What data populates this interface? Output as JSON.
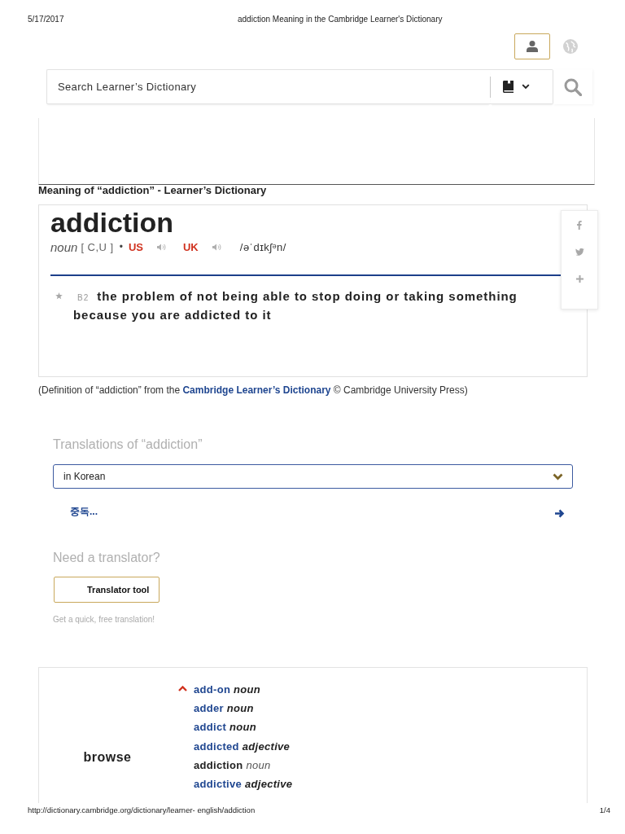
{
  "print_header": {
    "date": "5/17/2017",
    "title": "addiction Meaning in the Cambridge Learner's Dictionary"
  },
  "search": {
    "placeholder": "Search Learner’s Dictionary"
  },
  "meaning_heading": "Meaning of “addiction” - Learner’s Dictionary",
  "entry": {
    "headword": "addiction",
    "pos": "noun",
    "grammar": "[ C,U ]",
    "separator": "•",
    "pronunciations": [
      {
        "region": "US"
      },
      {
        "region": "UK"
      }
    ],
    "ipa": "/əˈdɪkʃᵊn/",
    "cefr": "B2",
    "definition": "the problem of not being able to stop doing or taking something because you are addicted to it"
  },
  "attribution": {
    "before": "(Definition of “addiction” from the ",
    "link": "Cambridge Learner’s Dictionary",
    "after": " © Cambridge University Press)"
  },
  "translations": {
    "heading": "Translations of “addiction”",
    "language": "in Korean",
    "result": "중독..."
  },
  "translator": {
    "heading": "Need a translator?",
    "button": "Translator tool",
    "hint": "Get a quick, free translation!"
  },
  "browse": {
    "label": "browse",
    "items": [
      {
        "word": "add-on",
        "pos": "noun",
        "selected": false
      },
      {
        "word": "adder",
        "pos": "noun",
        "selected": false
      },
      {
        "word": "addict",
        "pos": "noun",
        "selected": false
      },
      {
        "word": "addicted",
        "pos": "adjective",
        "selected": false
      },
      {
        "word": "addiction",
        "pos": "noun",
        "selected": true
      },
      {
        "word": "addictive",
        "pos": "adjective",
        "selected": false
      }
    ]
  },
  "footer": {
    "url": "http://dictionary.cambridge.org/dictionary/learner- english/addiction",
    "page": "1/4"
  }
}
